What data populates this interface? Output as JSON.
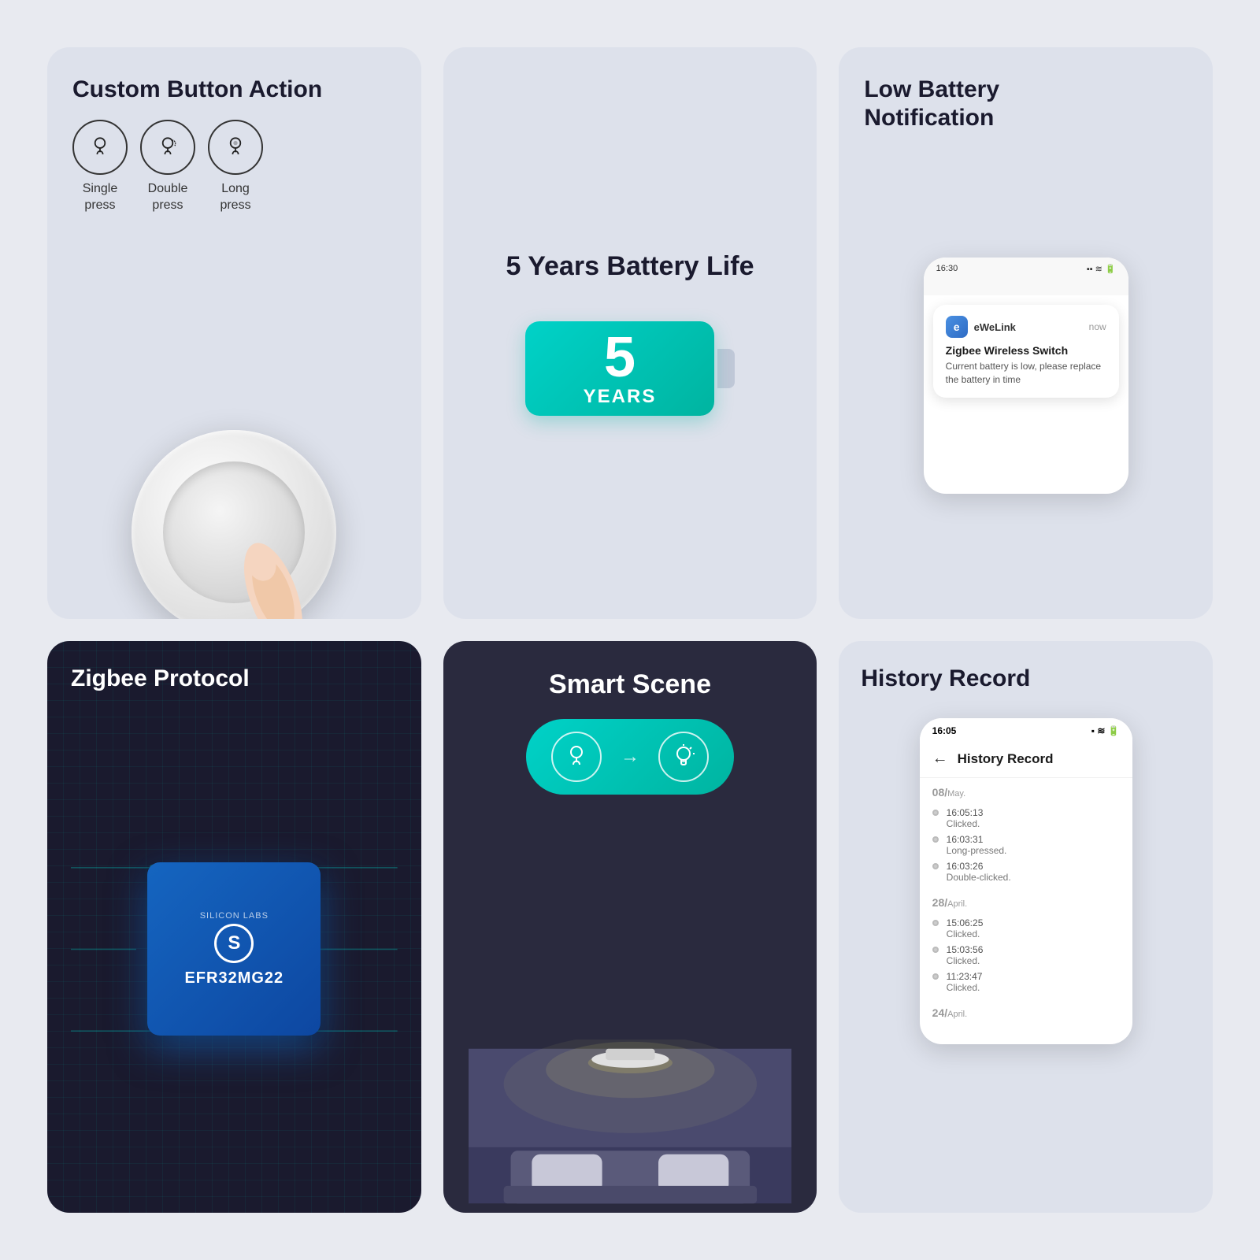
{
  "cards": {
    "button_action": {
      "title": "Custom Button Action",
      "press_types": [
        {
          "id": "single",
          "label": "Single\npress"
        },
        {
          "id": "double",
          "label": "Double\npress"
        },
        {
          "id": "long",
          "label": "Long\npress"
        }
      ]
    },
    "battery": {
      "title": "5 Years Battery Life",
      "years_number": "5",
      "years_label": "YEARS"
    },
    "low_battery": {
      "title": "Low Battery\nNotification",
      "phone": {
        "time": "16:30",
        "app_name": "eWeLink",
        "notif_time": "now",
        "notif_title": "Zigbee Wireless Switch",
        "notif_body": "Current battery is low, please replace the battery in time"
      }
    },
    "zigbee": {
      "title": "Zigbee Protocol",
      "chip": {
        "brand": "SILICON LABS",
        "model": "EFR32MG22"
      }
    },
    "smart_scene": {
      "title": "Smart Scene"
    },
    "history": {
      "title": "History Record",
      "phone": {
        "time": "16:05",
        "header": "History Record",
        "groups": [
          {
            "date": "08/",
            "month": "May.",
            "entries": [
              {
                "time": "16:05:13",
                "action": "Clicked."
              },
              {
                "time": "16:03:31",
                "action": "Long-pressed."
              },
              {
                "time": "16:03:26",
                "action": "Double-clicked."
              }
            ]
          },
          {
            "date": "28/",
            "month": "April.",
            "entries": [
              {
                "time": "15:06:25",
                "action": "Clicked."
              },
              {
                "time": "15:03:56",
                "action": "Clicked."
              },
              {
                "time": "11:23:47",
                "action": "Clicked."
              }
            ]
          },
          {
            "date": "24/",
            "month": "April.",
            "entries": []
          }
        ]
      }
    }
  }
}
